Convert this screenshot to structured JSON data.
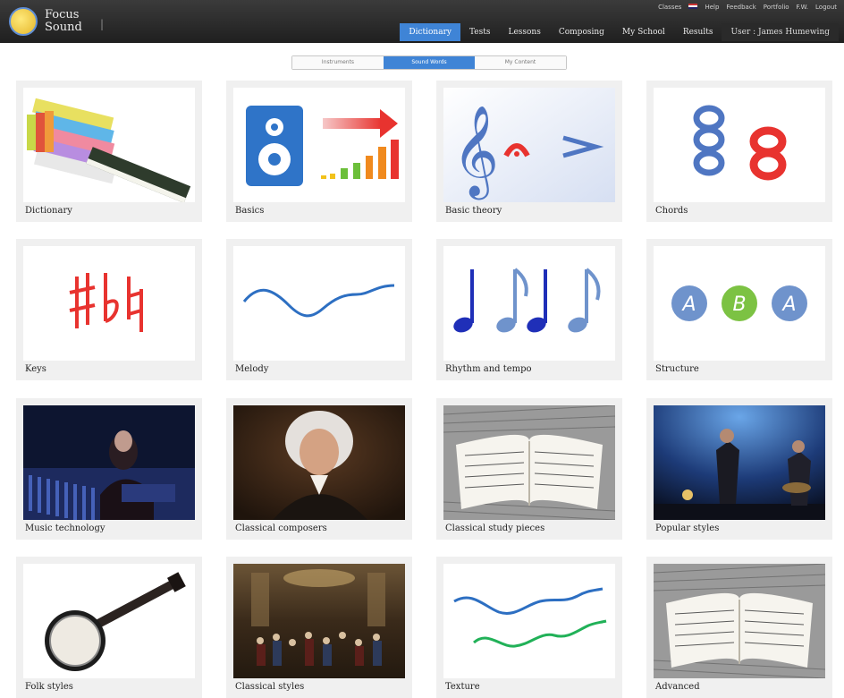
{
  "app": {
    "logo_line1": "Focus",
    "logo_line2": "Sound",
    "logo_sep": "|"
  },
  "utility_links": [
    "Classes",
    "Help",
    "Feedback",
    "Portfolio",
    "F.W.",
    "Logout"
  ],
  "nav": {
    "items": [
      "Dictionary",
      "Tests",
      "Lessons",
      "Composing",
      "My School",
      "Results"
    ],
    "active": "Dictionary",
    "user": "User : James Humewing"
  },
  "subtabs": {
    "items": [
      "Instruments",
      "Sound Words",
      "My Content"
    ],
    "active": "Sound Words"
  },
  "cards": [
    {
      "label": "Dictionary",
      "icon": "books-icon"
    },
    {
      "label": "Basics",
      "icon": "speaker-icon"
    },
    {
      "label": "Basic theory",
      "icon": "clef-icon"
    },
    {
      "label": "Chords",
      "icon": "chord-icon"
    },
    {
      "label": "Keys",
      "icon": "accidentals-icon"
    },
    {
      "label": "Melody",
      "icon": "melody-wave-icon"
    },
    {
      "label": "Rhythm and tempo",
      "icon": "notes-icon"
    },
    {
      "label": "Structure",
      "icon": "aba-icon"
    },
    {
      "label": "Music technology",
      "icon": "studio-photo"
    },
    {
      "label": "Classical composers",
      "icon": "composer-portrait"
    },
    {
      "label": "Classical study pieces",
      "icon": "score-book-photo"
    },
    {
      "label": "Popular styles",
      "icon": "band-photo"
    },
    {
      "label": "Folk styles",
      "icon": "banjo-icon"
    },
    {
      "label": "Classical styles",
      "icon": "orchestra-painting"
    },
    {
      "label": "Texture",
      "icon": "texture-waves-icon"
    },
    {
      "label": "Advanced",
      "icon": "score-book-photo"
    }
  ],
  "colors": {
    "accent": "#3f84d6",
    "topbar": "#2b2b2b",
    "card_bg": "#f0f0f0"
  }
}
